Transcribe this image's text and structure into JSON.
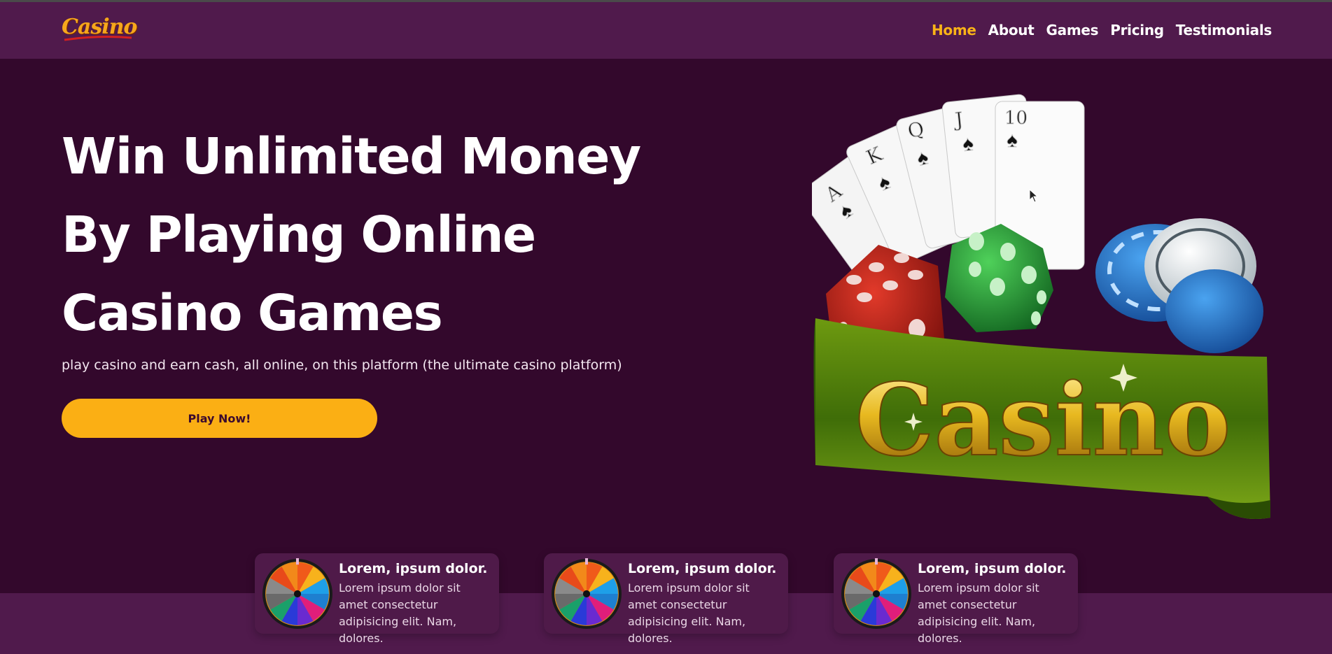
{
  "header": {
    "logo_text": "Casino",
    "nav": [
      {
        "label": "Home",
        "active": true
      },
      {
        "label": "About"
      },
      {
        "label": "Games"
      },
      {
        "label": "Pricing"
      },
      {
        "label": "Testimonials"
      }
    ]
  },
  "hero": {
    "title": "Win Unlimited Money By Playing Online Casino Games",
    "subtitle": "play casino and earn cash, all online, on this platform (the ultimate casino platform)",
    "cta_label": "Play Now!",
    "image": {
      "banner_text": "Casino",
      "cards": [
        "A",
        "K",
        "Q",
        "J",
        "10"
      ]
    }
  },
  "features": [
    {
      "title": "Lorem, ipsum dolor.",
      "text": "Lorem ipsum dolor sit amet consectetur adipisicing elit. Nam, dolores.",
      "icon": "roulette-wheel-icon"
    },
    {
      "title": "Lorem, ipsum dolor.",
      "text": "Lorem ipsum dolor sit amet consectetur adipisicing elit. Nam, dolores.",
      "icon": "roulette-wheel-icon"
    },
    {
      "title": "Lorem, ipsum dolor.",
      "text": "Lorem ipsum dolor sit amet consectetur adipisicing elit. Nam, dolores.",
      "icon": "roulette-wheel-icon"
    }
  ],
  "colors": {
    "header_bg": "#501a4c",
    "page_bg": "#33082c",
    "accent": "#fbaf14",
    "active_nav": "#f9b317"
  }
}
